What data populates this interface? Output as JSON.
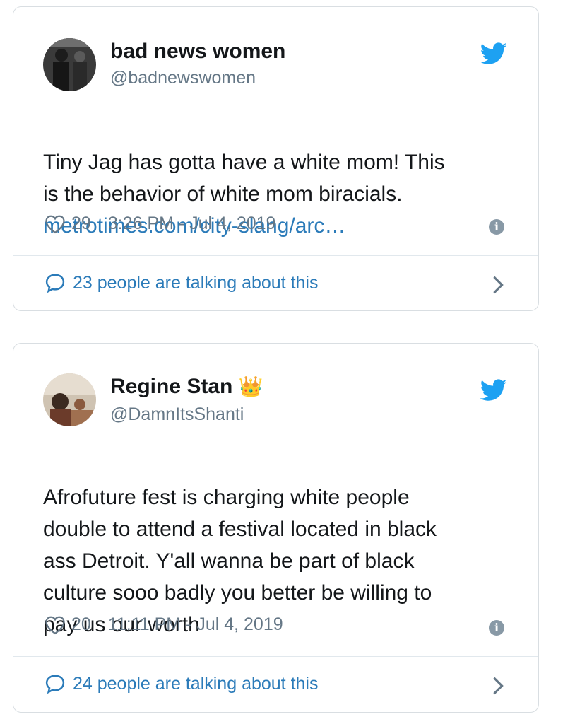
{
  "tweets": [
    {
      "name": "bad news women",
      "name_emoji": "",
      "handle": "@badnewswomen",
      "text": "Tiny Jag has gotta have a white mom! This\nis the behavior of white mom biracials.",
      "link": "metrotimes.com/city-slang/arc…",
      "likes": "29",
      "timestamp": "3:26 PM - Jul 4, 2019",
      "talking": "23 people are talking about this",
      "icons": [
        "twitter-bird-icon",
        "heart-icon",
        "info-icon",
        "speech-bubble-icon",
        "chevron-right-icon"
      ]
    },
    {
      "name": "Regine Stan",
      "name_emoji": "👑",
      "handle": "@DamnItsShanti",
      "text": "Afrofuture fest is charging white people\ndouble to attend a festival located in black\nass Detroit. Y'all wanna be part of black\nculture sooo badly you better be willing to\npay us our worth",
      "link": "",
      "likes": "20",
      "timestamp": "11:11 PM - Jul 4, 2019",
      "talking": "24 people are talking about this",
      "icons": [
        "twitter-bird-icon",
        "heart-icon",
        "info-icon",
        "speech-bubble-icon",
        "chevron-right-icon"
      ]
    }
  ],
  "colors": {
    "twitter_blue": "#1da1f2",
    "link_blue": "#2b7bb9",
    "secondary_text": "#657786",
    "border": "#d9dee2"
  }
}
